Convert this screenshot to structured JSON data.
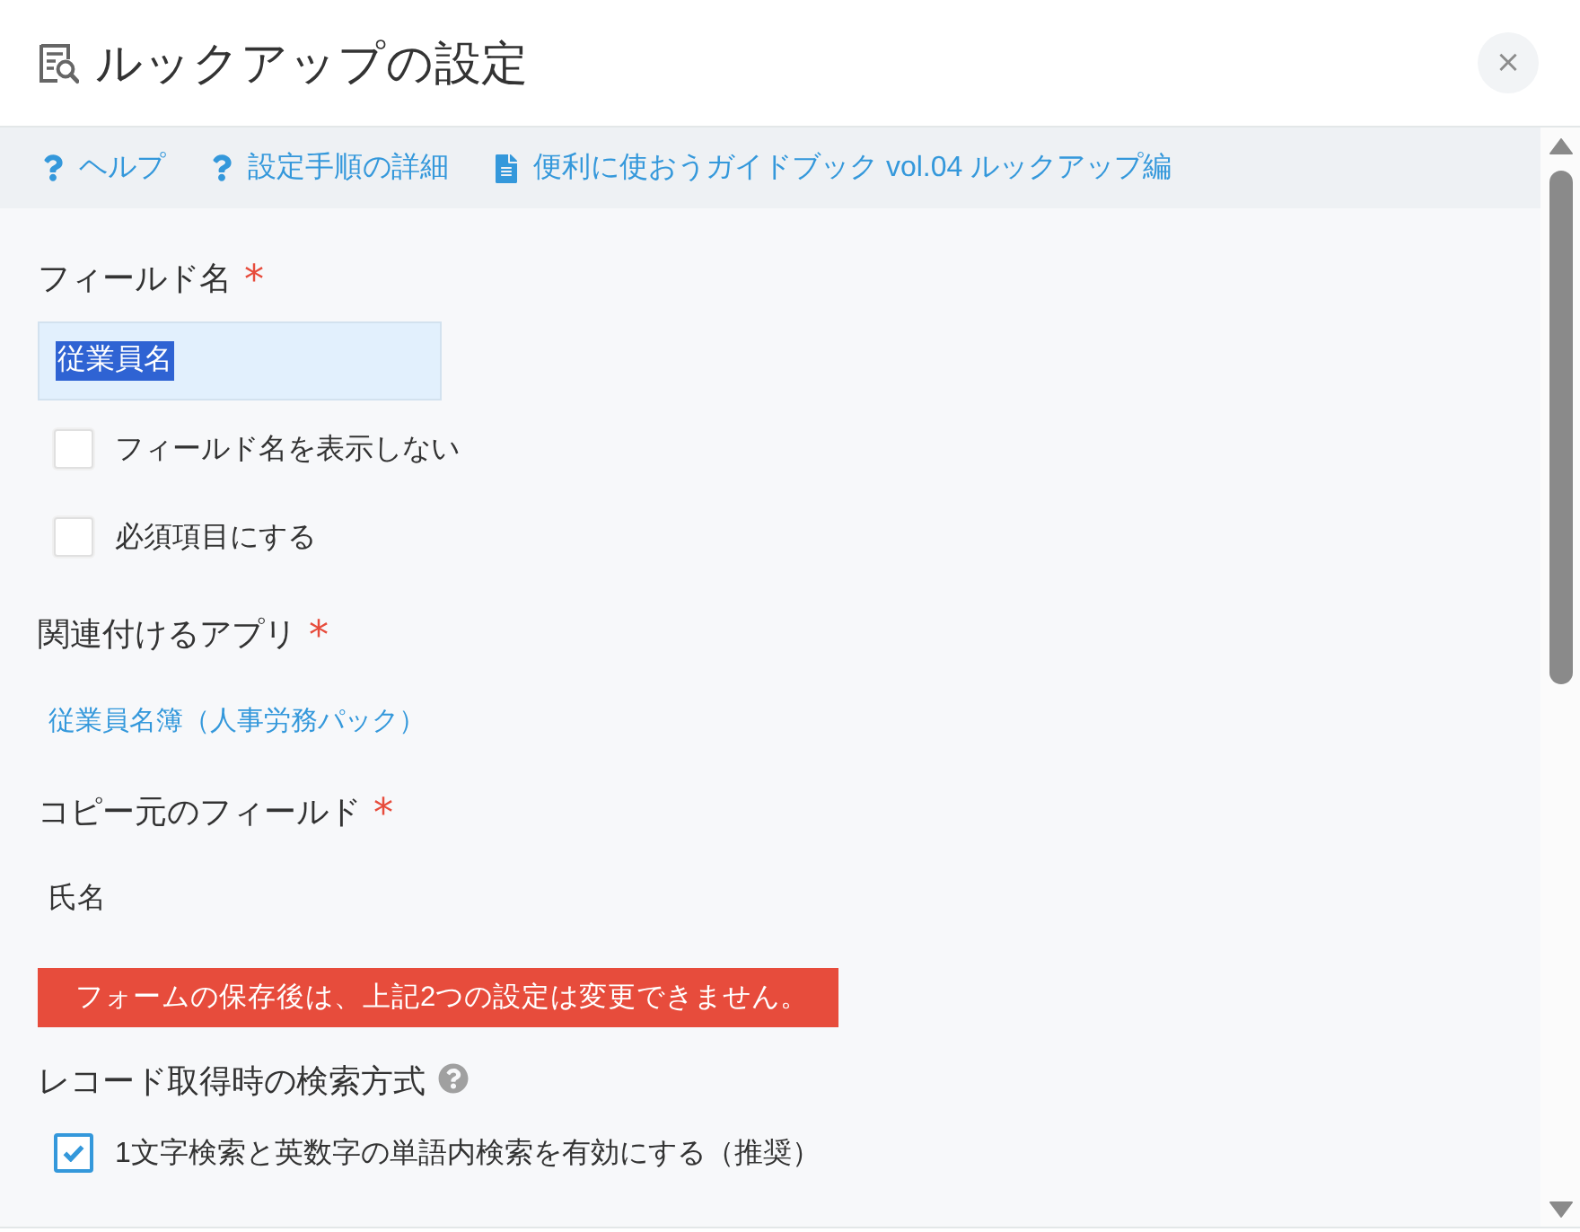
{
  "dialog": {
    "title": "ルックアップの設定",
    "close_label": "×"
  },
  "help_links": [
    {
      "kind": "help",
      "label": "ヘルプ"
    },
    {
      "kind": "help",
      "label": "設定手順の詳細"
    },
    {
      "kind": "document",
      "label": "便利に使おうガイドブック vol.04 ルックアップ編"
    }
  ],
  "field_name": {
    "label": "フィールド名",
    "required_mark": "*",
    "value": "従業員名",
    "text_selected": true
  },
  "field_options": [
    {
      "label": "フィールド名を表示しない",
      "checked": false
    },
    {
      "label": "必須項目にする",
      "checked": false
    }
  ],
  "related_app": {
    "label": "関連付けるアプリ",
    "required_mark": "*",
    "value": "従業員名簿（人事労務パック）"
  },
  "source_field": {
    "label": "コピー元のフィールド",
    "required_mark": "*",
    "value": "氏名"
  },
  "warning": "フォームの保存後は、上記2つの設定は変更できません。",
  "search_method": {
    "label": "レコード取得時の検索方式",
    "options": [
      {
        "label": "1文字検索と英数字の単語内検索を有効にする（推奨）",
        "checked": true
      }
    ]
  }
}
